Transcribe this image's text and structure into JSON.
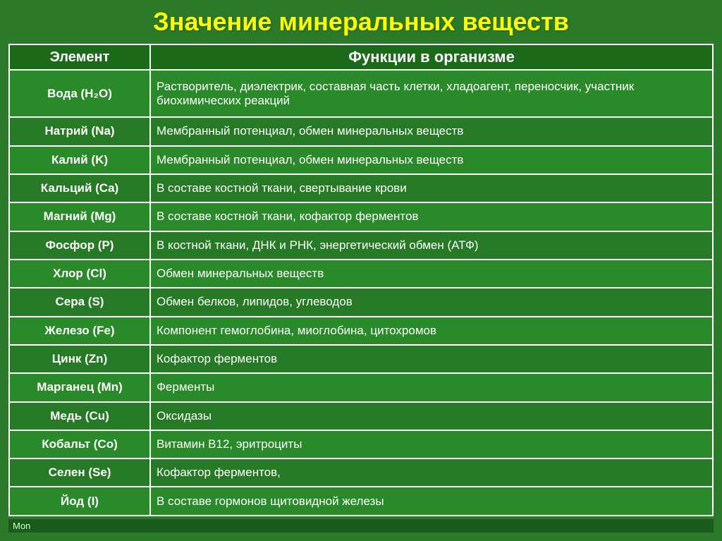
{
  "title": "Значение минеральных веществ",
  "table": {
    "header": {
      "col1": "Элемент",
      "col2": "Функции в организме"
    },
    "rows": [
      {
        "element": "Вода (H₂O)",
        "function": "Растворитель, диэлектрик, составная часть клетки, хладоагент, переносчик, участник биохимических реакций"
      },
      {
        "element": "Натрий (Na)",
        "function": "Мембранный потенциал, обмен минеральных веществ"
      },
      {
        "element": "Калий (K)",
        "function": "Мембранный потенциал, обмен минеральных веществ"
      },
      {
        "element": "Кальций (Ca)",
        "function": "В составе костной ткани, свертывание крови"
      },
      {
        "element": "Магний (Mg)",
        "function": "В составе костной ткани, кофактор ферментов"
      },
      {
        "element": "Фосфор (P)",
        "function": "В костной ткани,  ДНК и РНК, энергетический обмен  (АТФ)"
      },
      {
        "element": "Хлор (Cl)",
        "function": "Обмен минеральных веществ"
      },
      {
        "element": "Сера (S)",
        "function": "Обмен белков, липидов, углеводов"
      },
      {
        "element": "Железо (Fe)",
        "function": "Компонент гемоглобина, миоглобина, цитохромов"
      },
      {
        "element": "Цинк (Zn)",
        "function": "Кофактор ферментов"
      },
      {
        "element": "Марганец (Mn)",
        "function": "Ферменты"
      },
      {
        "element": "Медь (Cu)",
        "function": "Оксидазы"
      },
      {
        "element": "Кобальт (Co)",
        "function": "Витамин В12, эритроциты"
      },
      {
        "element": "Селен (Se)",
        "function": "Кофактор ферментов,"
      },
      {
        "element": "Йод (I)",
        "function": "В составе гормонов щитовидной железы"
      }
    ]
  },
  "bottom_text": "Mon"
}
